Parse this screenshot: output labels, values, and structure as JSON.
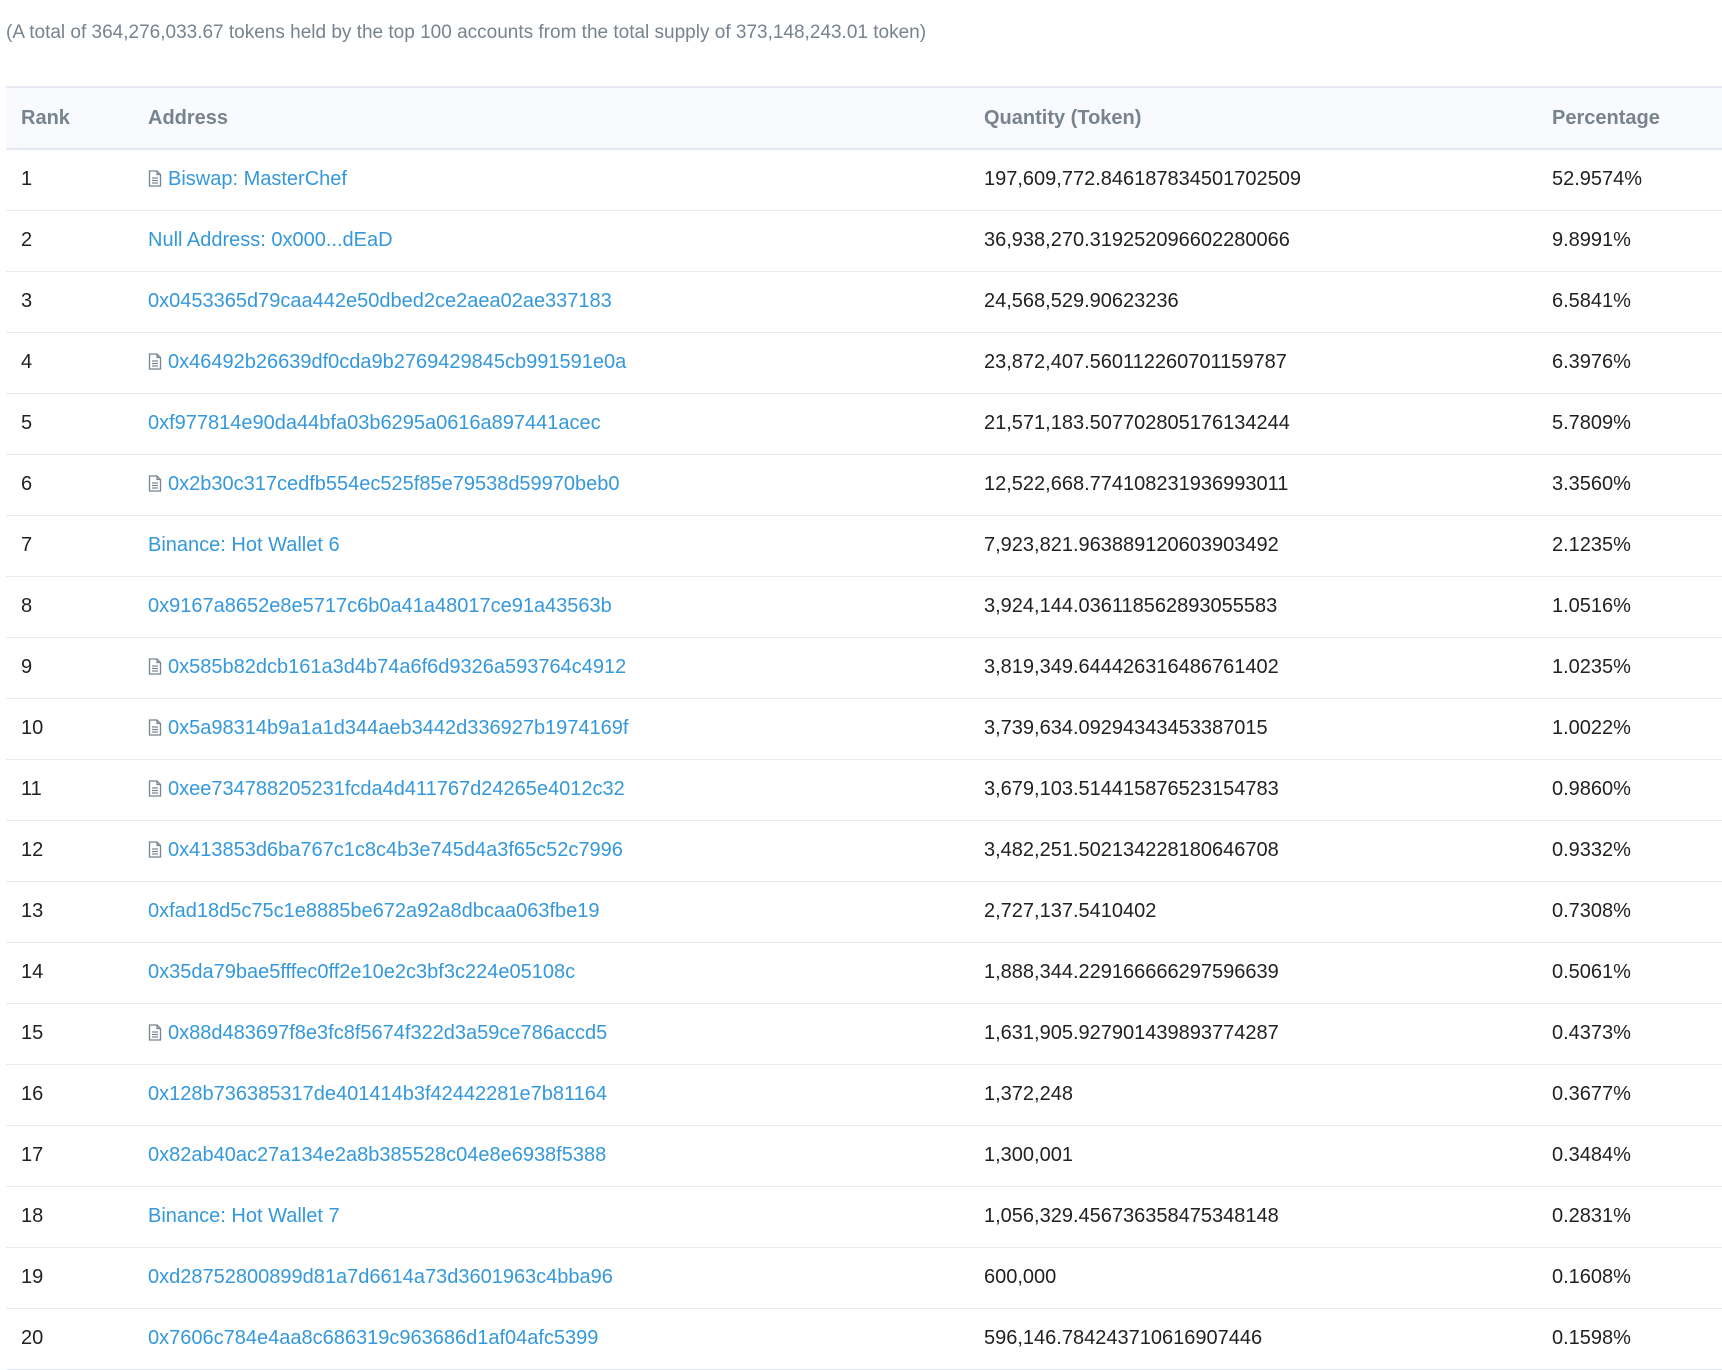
{
  "summary": "(A total of 364,276,033.67 tokens held by the top 100 accounts from the total supply of 373,148,243.01 token)",
  "columns": {
    "rank": "Rank",
    "address": "Address",
    "quantity": "Quantity (Token)",
    "percentage": "Percentage"
  },
  "rows": [
    {
      "rank": "1",
      "address": "Biswap: MasterChef",
      "contract": true,
      "quantity": "197,609,772.846187834501702509",
      "percentage": "52.9574%"
    },
    {
      "rank": "2",
      "address": "Null Address: 0x000...dEaD",
      "contract": false,
      "quantity": "36,938,270.319252096602280066",
      "percentage": "9.8991%"
    },
    {
      "rank": "3",
      "address": "0x0453365d79caa442e50dbed2ce2aea02ae337183",
      "contract": false,
      "quantity": "24,568,529.90623236",
      "percentage": "6.5841%"
    },
    {
      "rank": "4",
      "address": "0x46492b26639df0cda9b2769429845cb991591e0a",
      "contract": true,
      "quantity": "23,872,407.560112260701159787",
      "percentage": "6.3976%"
    },
    {
      "rank": "5",
      "address": "0xf977814e90da44bfa03b6295a0616a897441acec",
      "contract": false,
      "quantity": "21,571,183.507702805176134244",
      "percentage": "5.7809%"
    },
    {
      "rank": "6",
      "address": "0x2b30c317cedfb554ec525f85e79538d59970beb0",
      "contract": true,
      "quantity": "12,522,668.774108231936993011",
      "percentage": "3.3560%"
    },
    {
      "rank": "7",
      "address": "Binance: Hot Wallet 6",
      "contract": false,
      "quantity": "7,923,821.963889120603903492",
      "percentage": "2.1235%"
    },
    {
      "rank": "8",
      "address": "0x9167a8652e8e5717c6b0a41a48017ce91a43563b",
      "contract": false,
      "quantity": "3,924,144.036118562893055583",
      "percentage": "1.0516%"
    },
    {
      "rank": "9",
      "address": "0x585b82dcb161a3d4b74a6f6d9326a593764c4912",
      "contract": true,
      "quantity": "3,819,349.644426316486761402",
      "percentage": "1.0235%"
    },
    {
      "rank": "10",
      "address": "0x5a98314b9a1a1d344aeb3442d336927b1974169f",
      "contract": true,
      "quantity": "3,739,634.09294343453387015",
      "percentage": "1.0022%"
    },
    {
      "rank": "11",
      "address": "0xee734788205231fcda4d411767d24265e4012c32",
      "contract": true,
      "quantity": "3,679,103.514415876523154783",
      "percentage": "0.9860%"
    },
    {
      "rank": "12",
      "address": "0x413853d6ba767c1c8c4b3e745d4a3f65c52c7996",
      "contract": true,
      "quantity": "3,482,251.502134228180646708",
      "percentage": "0.9332%"
    },
    {
      "rank": "13",
      "address": "0xfad18d5c75c1e8885be672a92a8dbcaa063fbe19",
      "contract": false,
      "quantity": "2,727,137.5410402",
      "percentage": "0.7308%"
    },
    {
      "rank": "14",
      "address": "0x35da79bae5fffec0ff2e10e2c3bf3c224e05108c",
      "contract": false,
      "quantity": "1,888,344.229166666297596639",
      "percentage": "0.5061%"
    },
    {
      "rank": "15",
      "address": "0x88d483697f8e3fc8f5674f322d3a59ce786accd5",
      "contract": true,
      "quantity": "1,631,905.927901439893774287",
      "percentage": "0.4373%"
    },
    {
      "rank": "16",
      "address": "0x128b736385317de401414b3f42442281e7b81164",
      "contract": false,
      "quantity": "1,372,248",
      "percentage": "0.3677%"
    },
    {
      "rank": "17",
      "address": "0x82ab40ac27a134e2a8b385528c04e8e6938f5388",
      "contract": false,
      "quantity": "1,300,001",
      "percentage": "0.3484%"
    },
    {
      "rank": "18",
      "address": "Binance: Hot Wallet 7",
      "contract": false,
      "quantity": "1,056,329.456736358475348148",
      "percentage": "0.2831%"
    },
    {
      "rank": "19",
      "address": "0xd28752800899d81a7d6614a73d3601963c4bba96",
      "contract": false,
      "quantity": "600,000",
      "percentage": "0.1608%"
    },
    {
      "rank": "20",
      "address": "0x7606c784e4aa8c686319c963686d1af04afc5399",
      "contract": false,
      "quantity": "596,146.784243710616907446",
      "percentage": "0.1598%"
    }
  ],
  "colors": {
    "link": "#3498db",
    "muted": "#77838f",
    "text": "#1e2022",
    "border": "#e7eaf3",
    "header_bg": "#f8fafd"
  },
  "icons": {
    "contract": "file-document-icon"
  }
}
